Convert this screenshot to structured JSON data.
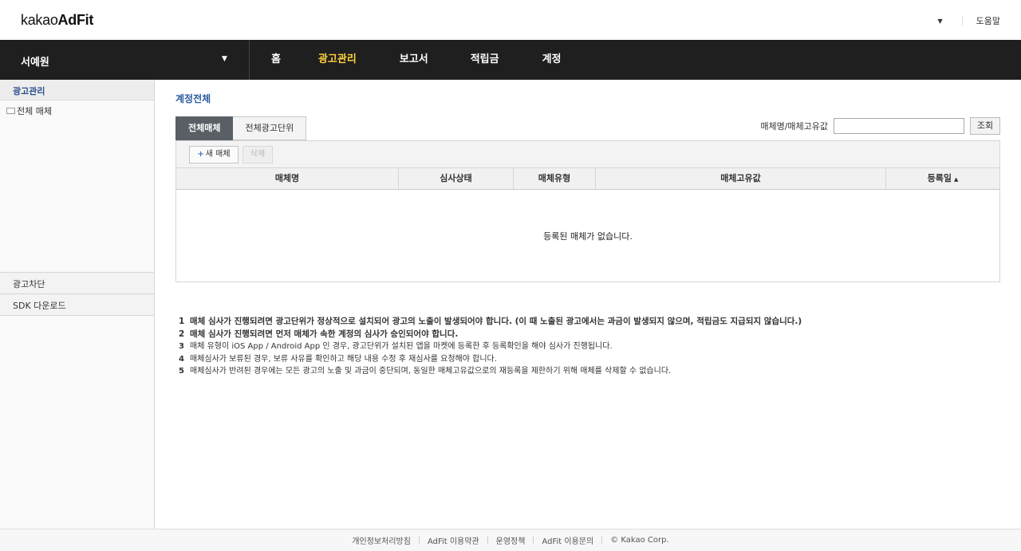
{
  "header": {
    "logo_prefix": "kakao",
    "logo_bold": "AdFit",
    "dropdown_caret": "▼",
    "help": "도움말"
  },
  "nav": {
    "account_name": "서예원",
    "account_caret": "▼",
    "menu": [
      {
        "label": "홈",
        "active": false
      },
      {
        "label": "광고관리",
        "active": true
      },
      {
        "label": "보고서",
        "active": false
      },
      {
        "label": "적립금",
        "active": false
      },
      {
        "label": "계정",
        "active": false
      }
    ],
    "accent_color": "#ffd23c"
  },
  "sidebar": {
    "section_title": "광고관리",
    "tree_item": "전체 매체",
    "links": [
      "광고차단",
      "SDK 다운로드"
    ]
  },
  "main": {
    "page_title": "계정전체",
    "tabs": [
      {
        "label": "전체매체",
        "active": true
      },
      {
        "label": "전체광고단위",
        "active": false
      }
    ],
    "search": {
      "label": "매체명/매체고유값",
      "value": "",
      "placeholder": "",
      "button": "조회"
    },
    "toolbar": {
      "new_button": "새 매체",
      "new_icon": "+",
      "delete_button": "삭제"
    },
    "table": {
      "columns": [
        "매체명",
        "심사상태",
        "매체유형",
        "매체고유값",
        "등록일"
      ],
      "sort_indicator": "▲",
      "empty_message": "등록된 매체가 없습니다."
    },
    "notes": [
      {
        "num": "1",
        "text": "매체 심사가 진행되려면 광고단위가 정상적으로 설치되어 광고의 노출이 발생되어야 합니다. (이 때 노출된 광고에서는 과금이 발생되지 않으며, 적립금도 지급되지 않습니다.)",
        "bold": true
      },
      {
        "num": "2",
        "text": "매체 심사가 진행되려면 먼저 매체가 속한 계정의 심사가 승인되어야 합니다.",
        "bold": true
      },
      {
        "num": "3",
        "text": "매체 유형이 iOS App / Android App 인 경우, 광고단위가 설치된 앱을 마켓에 등록한 후 등록확인을 해야 심사가 진행됩니다.",
        "bold": false
      },
      {
        "num": "4",
        "text": "매체심사가 보류된 경우, 보류 사유를 확인하고 해당 내용 수정 후 재심사를 요청해야 합니다.",
        "bold": false
      },
      {
        "num": "5",
        "text": "매체심사가 반려된 경우에는 모든 광고의 노출 및 과금이 중단되며, 동일한 매체고유값으로의 재등록을 제한하기 위해 매체를 삭제할 수 없습니다.",
        "bold": false
      }
    ]
  },
  "footer": {
    "links": [
      "개인정보처리방침",
      "AdFit 이용약관",
      "운영정책",
      "AdFit 이용문의"
    ],
    "copyright": "© Kakao Corp."
  }
}
